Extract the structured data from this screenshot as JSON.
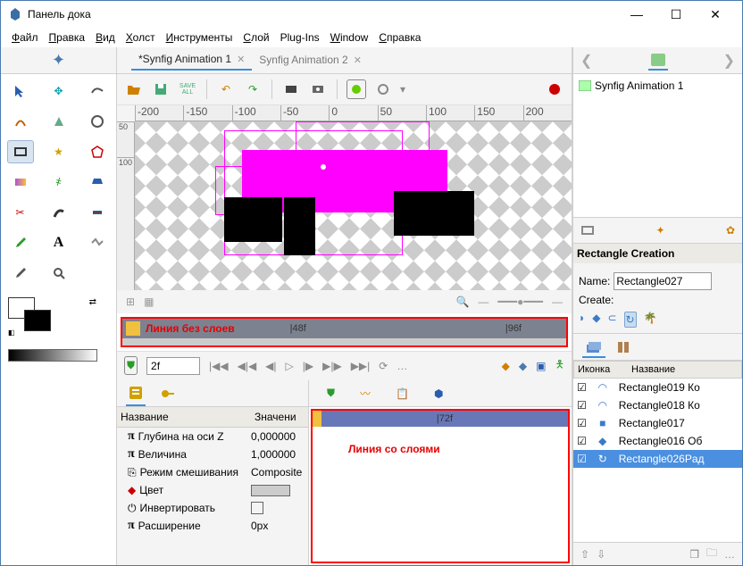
{
  "title": "Панель дока",
  "menu": [
    "Файл",
    "Правка",
    "Вид",
    "Холст",
    "Инструменты",
    "Слой",
    "Plug-Ins",
    "Window",
    "Справка"
  ],
  "menu_u": [
    "Ф",
    "П",
    "В",
    "Х",
    "И",
    "С",
    "",
    "W",
    "С"
  ],
  "tabs": {
    "t1": "*Synfig Animation 1",
    "t2": "Synfig Animation 2"
  },
  "ruler_h": [
    "-200",
    "-150",
    "-100",
    "-50",
    "0",
    "50",
    "100",
    "150",
    "200"
  ],
  "ruler_v": [
    "50",
    "100"
  ],
  "ann1": "Линия без слоев",
  "tick48": "|48f",
  "tick96": "|96f",
  "tick72": "|72f",
  "ann2": "Линия со слоями",
  "frame": "2f",
  "save_all": "SAVE\nALL",
  "params_head": {
    "c1": "Название",
    "c2": "Значени"
  },
  "params": [
    {
      "icon": "π",
      "label": "Глубина на оси Z",
      "val": "0,000000"
    },
    {
      "icon": "π",
      "label": "Величина",
      "val": "1,000000"
    },
    {
      "icon": "⎘",
      "label": "Режим смешивания",
      "val": "Composite"
    },
    {
      "icon": "◆",
      "label": "Цвет",
      "val": ""
    },
    {
      "icon": "⏻",
      "label": "Инвертировать",
      "val": ""
    },
    {
      "icon": "π",
      "label": "Расширение",
      "val": "0px"
    }
  ],
  "nav_item": "Synfig Animation 1",
  "rsec_title": "Rectangle Creation",
  "name_lbl": "Name:",
  "name_val": "Rectangle027",
  "create_lbl": "Create:",
  "layer_head": {
    "c1": "Иконка",
    "c2": "Название"
  },
  "layers": [
    {
      "icon": "◠",
      "name": "Rectangle019 Ко",
      "sel": false,
      "col": "#3a7bc8"
    },
    {
      "icon": "◠",
      "name": "Rectangle018 Ко",
      "sel": false,
      "col": "#3a7bc8"
    },
    {
      "icon": "■",
      "name": "Rectangle017",
      "sel": false,
      "col": "#3a7bc8"
    },
    {
      "icon": "◆",
      "name": "Rectangle016 Об",
      "sel": false,
      "col": "#3a7bc8"
    },
    {
      "icon": "↻",
      "name": "Rectangle026Pад",
      "sel": true,
      "col": "#fff"
    }
  ]
}
